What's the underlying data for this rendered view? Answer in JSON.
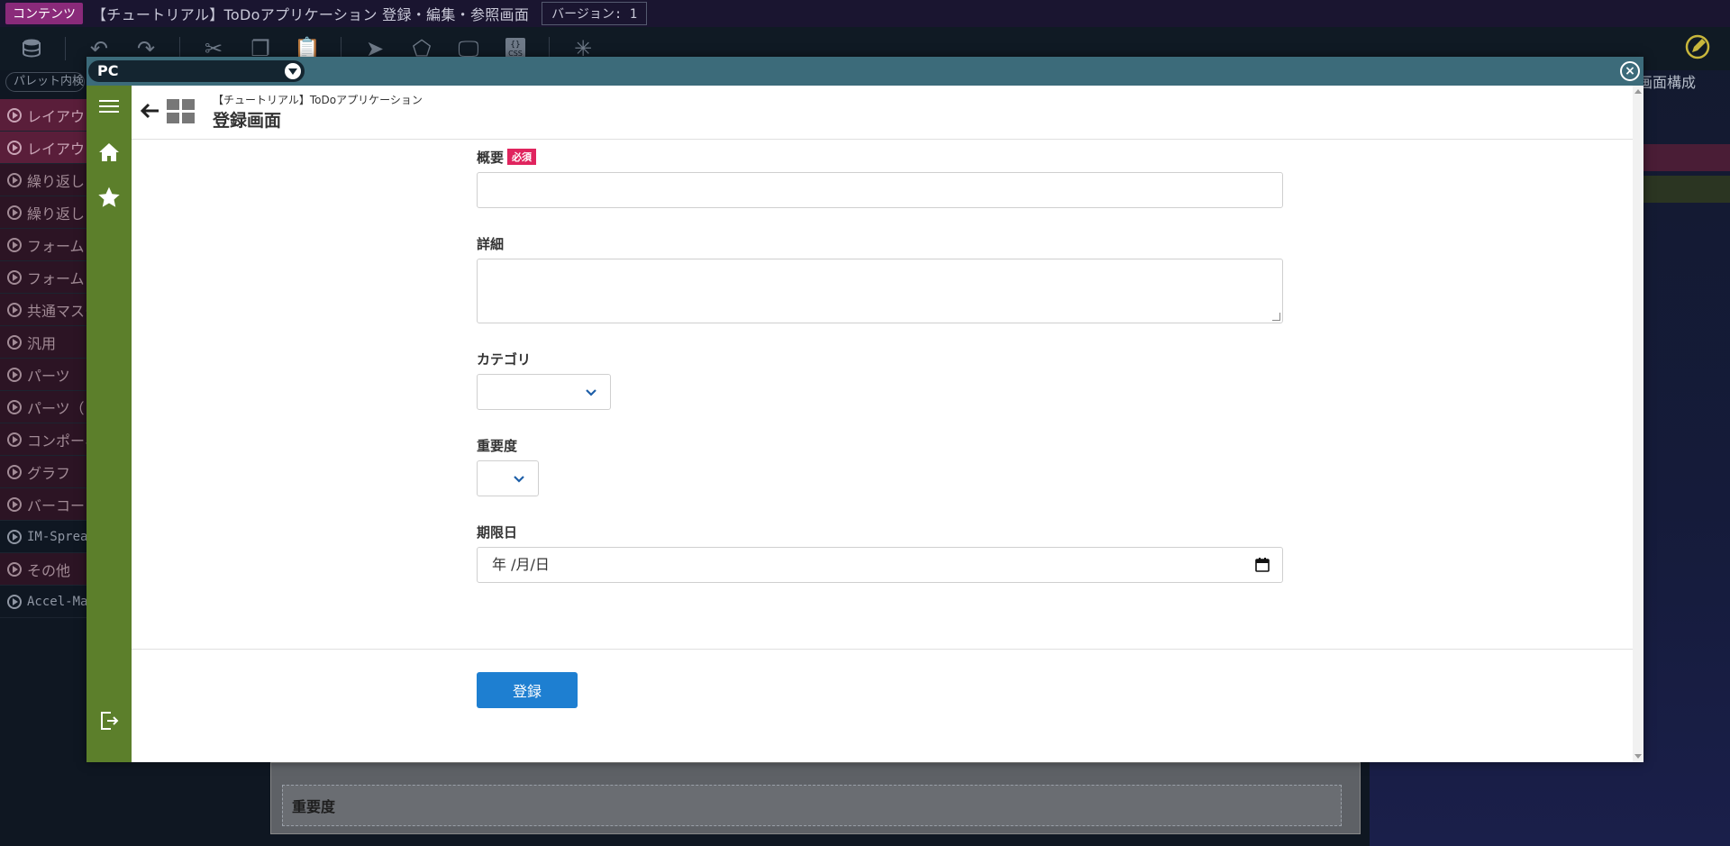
{
  "ide": {
    "badge": "コンテンツ",
    "title": "【チュートリアル】ToDoアプリケーション 登録・編集・参照画面",
    "version": "バージョン: 1",
    "palette_search": "パレット内検索",
    "palette_items": [
      {
        "label": "レイアウト",
        "style": "pink"
      },
      {
        "label": "レイアウト",
        "style": "pink"
      },
      {
        "label": "繰り返し",
        "style": "dark"
      },
      {
        "label": "繰り返し",
        "style": "dark"
      },
      {
        "label": "フォーム",
        "style": "dark"
      },
      {
        "label": "フォーム",
        "style": "dark"
      },
      {
        "label": "共通マスタ",
        "style": "dark"
      },
      {
        "label": "汎用",
        "style": "dark"
      },
      {
        "label": "パーツ",
        "style": "dark"
      },
      {
        "label": "パーツ（",
        "style": "dark"
      },
      {
        "label": "コンポーネント",
        "style": "dark"
      },
      {
        "label": "グラフ",
        "style": "dark"
      },
      {
        "label": "バーコード",
        "style": "dark"
      },
      {
        "label": "IM-Spread",
        "style": "mono"
      },
      {
        "label": "その他",
        "style": "dark"
      },
      {
        "label": "Accel-Mart",
        "style": "mono"
      }
    ],
    "right_label": "画面構成",
    "canvas_label": "重要度"
  },
  "modal": {
    "device": "PC",
    "close": "×"
  },
  "app": {
    "subtitle": "【チュートリアル】ToDoアプリケーション",
    "title": "登録画面",
    "fields": {
      "summary_label": "概要",
      "required_badge": "必須",
      "detail_label": "詳細",
      "category_label": "カテゴリ",
      "priority_label": "重要度",
      "due_label": "期限日",
      "due_placeholder": "年 /月/日"
    },
    "submit_label": "登録"
  }
}
